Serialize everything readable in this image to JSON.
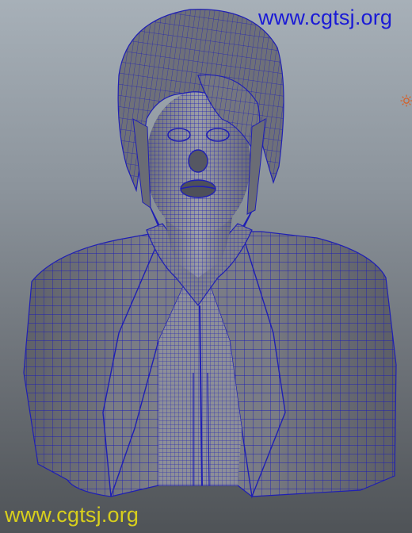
{
  "watermark": {
    "top_text": "www.cgtsj.org",
    "bottom_text": "www.cgtsj.org",
    "top_color": "#1a1ad6",
    "bottom_color": "#d8cf1c"
  },
  "viewport": {
    "background_top": "#a7b0b8",
    "background_bottom": "#4f5357",
    "mesh_fill": "#7d7f87",
    "wire_color": "#1f1fb4",
    "icon": "light-icon"
  }
}
